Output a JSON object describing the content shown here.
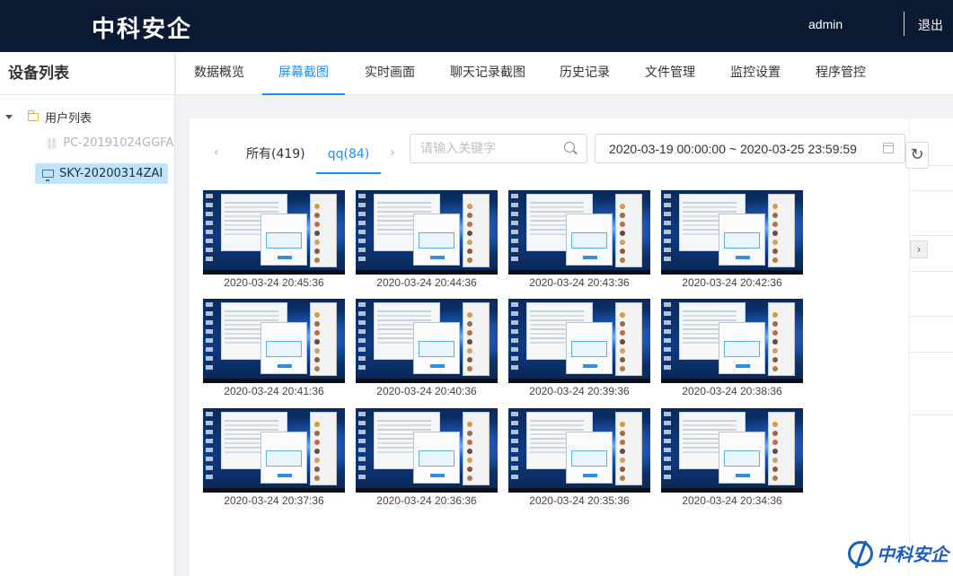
{
  "header": {
    "brand": "中科安企",
    "user": "admin",
    "logout": "退出"
  },
  "sidebar": {
    "title": "设备列表",
    "group_label": "用户列表",
    "devices": [
      {
        "label": "PC-20191024GGFA",
        "status": "offline"
      },
      {
        "label": "SKY-20200314ZAI",
        "status": "online",
        "selected": true
      }
    ]
  },
  "nav": {
    "tabs": [
      "数据概览",
      "屏幕截图",
      "实时画面",
      "聊天记录截图",
      "历史记录",
      "文件管理",
      "监控设置",
      "程序管控"
    ],
    "active_index": 1
  },
  "filter": {
    "tabs": [
      "所有(419)",
      "qq(84)"
    ],
    "active_index": 1,
    "search_placeholder": "请输入关键字",
    "date_range": "2020-03-19 00:00:00 ~ 2020-03-25 23:59:59"
  },
  "screenshots": [
    "2020-03-24 20:45:36",
    "2020-03-24 20:44:36",
    "2020-03-24 20:43:36",
    "2020-03-24 20:42:36",
    "2020-03-24 20:41:36",
    "2020-03-24 20:40:36",
    "2020-03-24 20:39:36",
    "2020-03-24 20:38:36",
    "2020-03-24 20:37:36",
    "2020-03-24 20:36:36",
    "2020-03-24 20:35:36",
    "2020-03-24 20:34:36"
  ],
  "watermark": {
    "text": "中科安企"
  },
  "colors": {
    "header_bg": "#0b1a33",
    "accent": "#1890ff",
    "selected_bg": "#bfe3fa"
  }
}
